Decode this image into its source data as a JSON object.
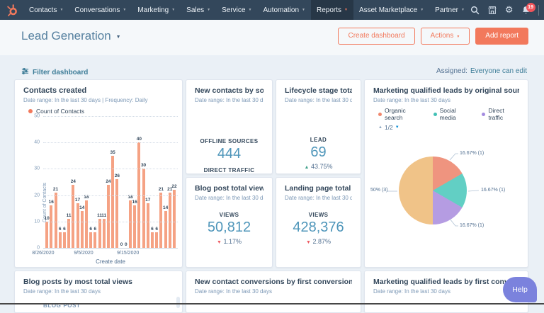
{
  "nav": {
    "items": [
      {
        "label": "Contacts",
        "active": false
      },
      {
        "label": "Conversations",
        "active": false
      },
      {
        "label": "Marketing",
        "active": false
      },
      {
        "label": "Sales",
        "active": false
      },
      {
        "label": "Service",
        "active": false
      },
      {
        "label": "Automation",
        "active": false
      },
      {
        "label": "Reports",
        "active": true
      },
      {
        "label": "Asset Marketplace",
        "active": false
      },
      {
        "label": "Partner",
        "active": false
      }
    ],
    "notification_count": "19"
  },
  "header": {
    "title": "Lead Generation",
    "create_dashboard_label": "Create dashboard",
    "actions_label": "Actions",
    "add_report_label": "Add report"
  },
  "filter_bar": {
    "filter_label": "Filter dashboard",
    "assigned_label": "Assigned:",
    "assigned_value": "Everyone can edit"
  },
  "cards": {
    "contacts_created": {
      "title": "Contacts created",
      "meta": "Date range: In the last 30 days  |  Frequency: Daily",
      "legend": "Count of Contacts"
    },
    "new_contacts_by_source": {
      "title": "New contacts by source",
      "meta": "Date range: In the last 30 days",
      "metric1_label": "OFFLINE SOURCES",
      "metric1_value": "444",
      "metric2_label": "DIRECT TRAFFIC"
    },
    "lifecycle": {
      "title": "Lifecycle stage totals",
      "meta": "Date range: In the last 30 days",
      "label": "LEAD",
      "value": "69",
      "delta": "43.75%"
    },
    "blog_views": {
      "title": "Blog post total views a...",
      "meta": "Date range: In the last 30 days",
      "label": "VIEWS",
      "value": "50,812",
      "delta": "1.17%"
    },
    "landing_views": {
      "title": "Landing page total vie...",
      "meta": "Date range: In the last 30 days",
      "label": "VIEWS",
      "value": "428,376",
      "delta": "2.87%"
    },
    "mql_source": {
      "title": "Marketing qualified leads by original source",
      "meta": "Date range: In the last 30 days",
      "pager": "1/2"
    },
    "blog_posts": {
      "title": "Blog posts by most total views",
      "meta": "Date range: In the last 30 days",
      "col_header": "BLOG POST"
    },
    "contact_conversions": {
      "title": "New contact conversions by first conversion",
      "meta": "Date range: In the last 30 days"
    },
    "mql_conversion": {
      "title": "Marketing qualified leads by first conversion",
      "meta": "Date range: In the last 30 days"
    }
  },
  "help_label": "Help",
  "colors": {
    "nav_bg": "#33475b",
    "accent_orange": "#f2795c",
    "metric_blue": "#4f96ba",
    "link_teal": "#3e7d98",
    "positive_green": "#42a28c",
    "negative_red": "#ee5d64",
    "badge_red": "#f2545b",
    "help_purple": "#7b82dd"
  },
  "chart_data": [
    {
      "type": "bar",
      "title": "Contacts created",
      "xlabel": "Create date",
      "ylabel": "Count of Contacts",
      "series_name": "Count of Contacts",
      "x_ticks": [
        "8/26/2020",
        "9/5/2020",
        "9/15/2020"
      ],
      "x_tick_pos": [
        0,
        30,
        63
      ],
      "y_ticks": [
        0,
        10,
        20,
        30,
        40,
        50
      ],
      "ylim": [
        0,
        50
      ],
      "values": [
        10,
        16,
        21,
        6,
        6,
        11,
        24,
        17,
        14,
        18,
        6,
        6,
        11,
        11,
        24,
        35,
        26,
        0,
        0,
        18,
        16,
        40,
        30,
        17,
        6,
        6,
        21,
        14,
        21,
        22
      ],
      "bar_color": "#f5a284",
      "grid": true,
      "legend_position": "top-left"
    },
    {
      "type": "pie",
      "title": "Marketing qualified leads by original source",
      "values": [
        16.67,
        16.67,
        16.67,
        50
      ],
      "colors": [
        "#ef947f",
        "#62cfc4",
        "#b59ce2",
        "#f0c388"
      ],
      "slice_labels": [
        "16.67% (1)",
        "16.67% (1)",
        "16.67% (1)",
        "50% (3)"
      ],
      "legend": [
        {
          "label": "Organic search",
          "color": "#f0876d"
        },
        {
          "label": "Social media",
          "color": "#41c0b5"
        },
        {
          "label": "Direct traffic",
          "color": "#a48ce0"
        }
      ],
      "legend_position": "top-left",
      "pager": "1/2"
    }
  ]
}
